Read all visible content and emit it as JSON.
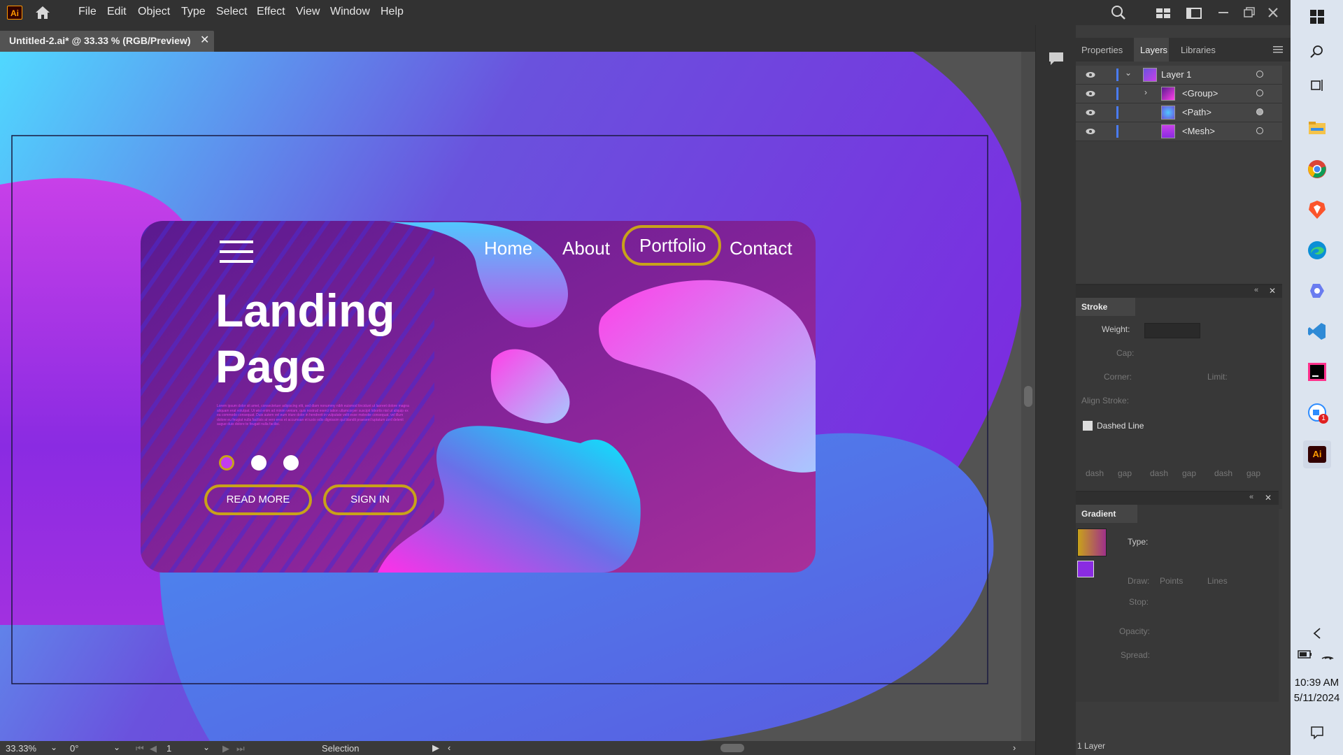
{
  "app": {
    "logo": "Ai",
    "menu": [
      "File",
      "Edit",
      "Object",
      "Type",
      "Select",
      "Effect",
      "View",
      "Window",
      "Help"
    ]
  },
  "document": {
    "tab_title": "Untitled-2.ai* @ 33.33 % (RGB/Preview)",
    "close": "✕"
  },
  "artwork": {
    "nav": [
      "Home",
      "About",
      "Portfolio",
      "Contact"
    ],
    "heading_line1": "Landing",
    "heading_line2": "Page",
    "body_text": "Lorem ipsum dolor sit amet, consectetuer adipiscing elit, sed diam nonummy nibh euismod tincidunt ut laoreet dolore magna aliquam erat volutpat. Ut wisi enim ad minim veniam, quis nostrud exerci tation ullamcorper suscipit lobortis nisl ut aliquip ex ea commodo consequat. Duis autem vel eum iriure dolor in hendrerit in vulputate velit esse molestie consequat, vel illum dolore eu feugiat nulla facilisis at vero eros et accumsan et iusto odio dignissim qui blandit praesent luptatum zzril delenit augue duis dolore te feugait nulla facilisi.",
    "btn_read_more": "READ MORE",
    "btn_sign_in": "SIGN IN",
    "colors": {
      "bg_start": "#4fd6ff",
      "bg_end": "#8a2be2",
      "card": "#6a1e9a",
      "accent_gold": "#c8a21a",
      "pink": "#ff3fe0",
      "cyan": "#00f0ff"
    }
  },
  "panels": {
    "tabs": [
      "Properties",
      "Layers",
      "Libraries"
    ],
    "active_tab": "Layers",
    "layers": [
      {
        "name": "Layer 1",
        "expanded": true
      },
      {
        "name": "<Group>",
        "expanded": false
      },
      {
        "name": "<Path>"
      },
      {
        "name": "<Mesh>"
      }
    ],
    "layers_footer": "1 Layer",
    "stroke": {
      "title": "Stroke",
      "weight_label": "Weight:",
      "cap_label": "Cap:",
      "corner_label": "Corner:",
      "limit_label": "Limit:",
      "align_label": "Align Stroke:",
      "dashed_label": "Dashed Line",
      "dash_gap": [
        "dash",
        "gap",
        "dash",
        "gap",
        "dash",
        "gap"
      ]
    },
    "gradient": {
      "title": "Gradient",
      "type_label": "Type:",
      "draw_label": "Draw:",
      "points_label": "Points",
      "lines_label": "Lines",
      "stop_label": "Stop:",
      "opacity_label": "Opacity:",
      "spread_label": "Spread:"
    }
  },
  "status": {
    "zoom": "33.33%",
    "rotation": "0°",
    "artboard": "1",
    "tool": "Selection"
  },
  "taskbar": {
    "time": "10:39 AM",
    "date": "5/11/2024",
    "badge": "1"
  }
}
